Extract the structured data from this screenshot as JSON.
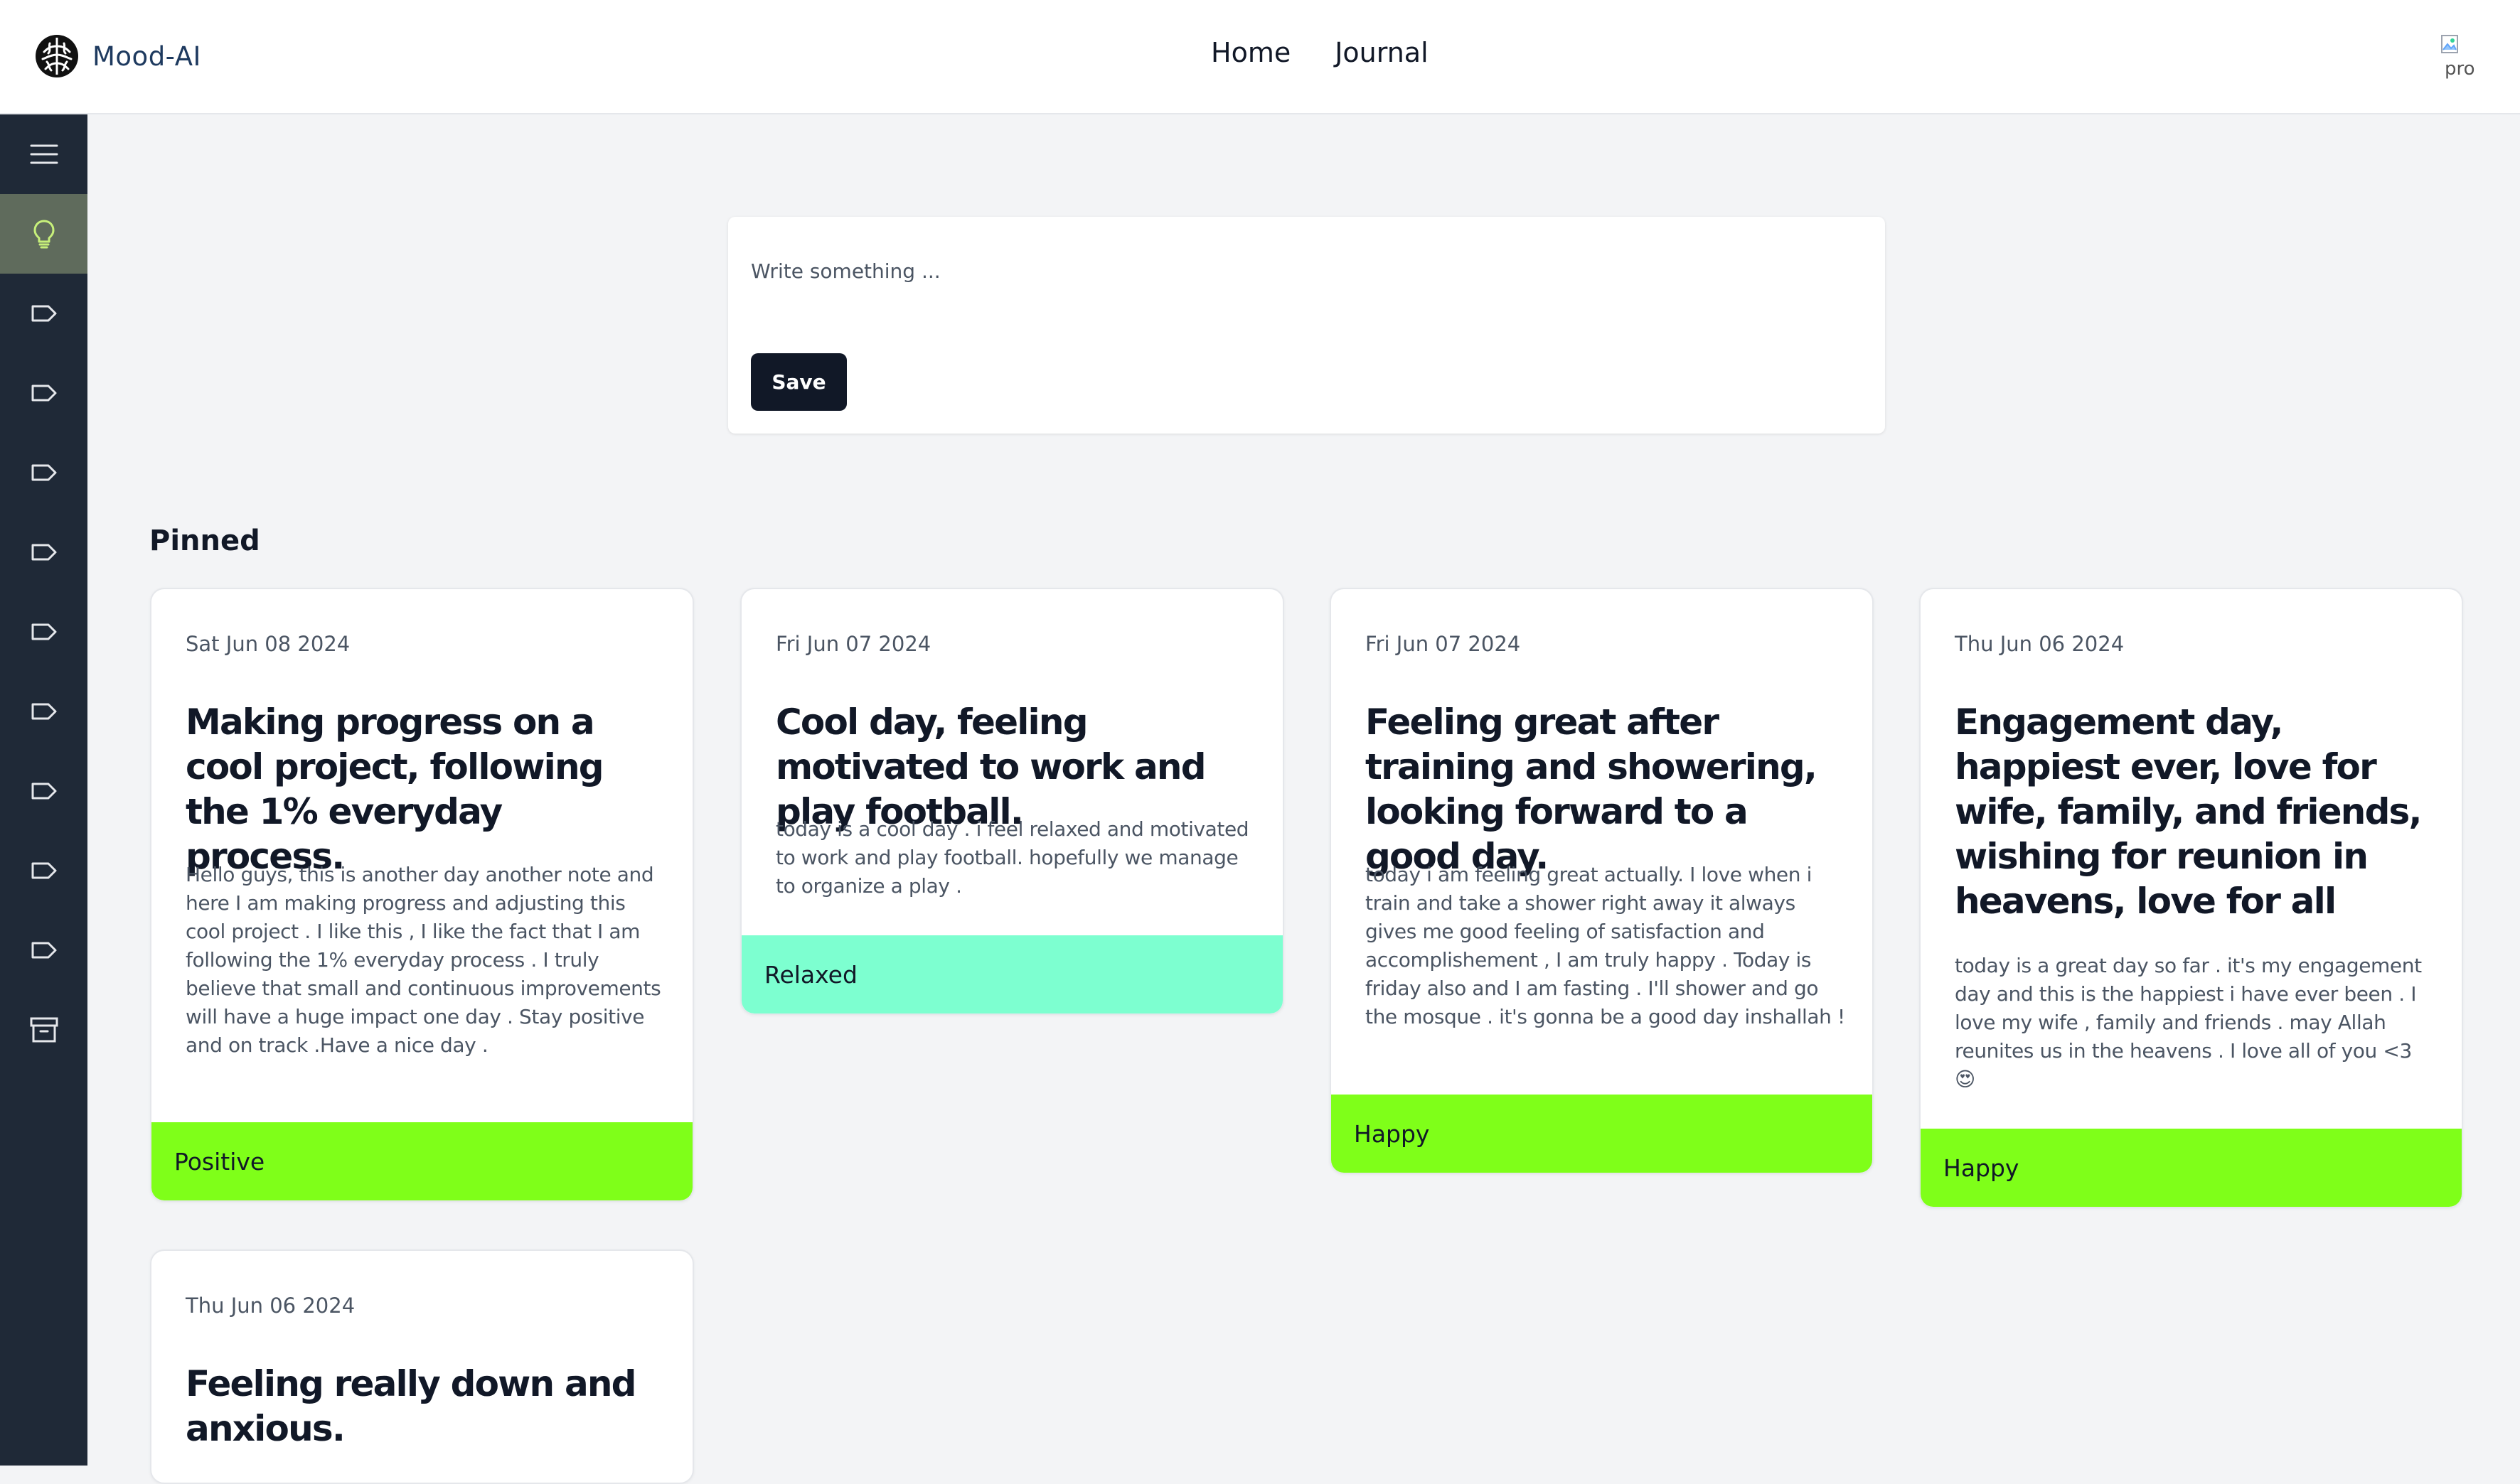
{
  "brand": {
    "name": "Mood-AI",
    "logo_icon": "brain-icon"
  },
  "nav": {
    "links": [
      "Home",
      "Journal"
    ]
  },
  "avatar": {
    "alt": "pro"
  },
  "sidebar": {
    "items": [
      {
        "icon": "menu-icon"
      },
      {
        "icon": "lightbulb-icon",
        "active": true
      },
      {
        "icon": "label-icon"
      },
      {
        "icon": "label-icon"
      },
      {
        "icon": "label-icon"
      },
      {
        "icon": "label-icon"
      },
      {
        "icon": "label-icon"
      },
      {
        "icon": "label-icon"
      },
      {
        "icon": "label-icon"
      },
      {
        "icon": "label-icon"
      },
      {
        "icon": "label-icon"
      },
      {
        "icon": "archive-icon"
      }
    ]
  },
  "editor": {
    "placeholder": "Write something ...",
    "save_label": "Save"
  },
  "section": {
    "title": "Pinned"
  },
  "cards": [
    {
      "date": "Sat Jun 08 2024",
      "title": "Making progress on a cool project, following the 1% everyday process.",
      "body": "Hello guys, this is another day another note and here I am making progress and adjusting this cool project . I like this , I like the fact that I am following the 1% everyday process . I truly believe that small and continuous improvements will have a huge impact one day . Stay positive and on track .Have a nice day .",
      "mood": "Positive",
      "mood_color": "#7fff19"
    },
    {
      "date": "Fri Jun 07 2024",
      "title": "Cool day, feeling motivated to work and play football.",
      "body": "today is a cool day . i feel relaxed and motivated to work and play football. hopefully we manage to organize a play .",
      "mood": "Relaxed",
      "mood_color": "#7dffd0"
    },
    {
      "date": "Fri Jun 07 2024",
      "title": "Feeling great after training and showering, looking forward to a good day.",
      "body": "today i am feeling great actually. I love when i train and take a shower right away it always gives me good feeling of satisfaction and accomplishement , I am truly happy . Today is friday also and I am fasting . I'll shower and go the mosque . it's gonna be a good day inshallah !",
      "mood": "Happy",
      "mood_color": "#7fff19"
    },
    {
      "date": "Thu Jun 06 2024",
      "title": "Engagement day, happiest ever, love for wife, family, and friends, wishing for reunion in heavens, love for all",
      "body": "today is a great day so far . it's my engagement day and this is the happiest i have ever been . I love my wife , family and friends . may Allah reunites us in the heavens . I love all of you <3 😍",
      "mood": "Happy",
      "mood_color": "#7fff19"
    },
    {
      "date": "Thu Jun 06 2024",
      "title": "Feeling really down and anxious."
    }
  ],
  "colors": {
    "sidebar_bg": "#1f2937",
    "sidebar_active": "#5f6b5c",
    "lightbulb": "#c7f07a",
    "save_button": "#111827"
  }
}
